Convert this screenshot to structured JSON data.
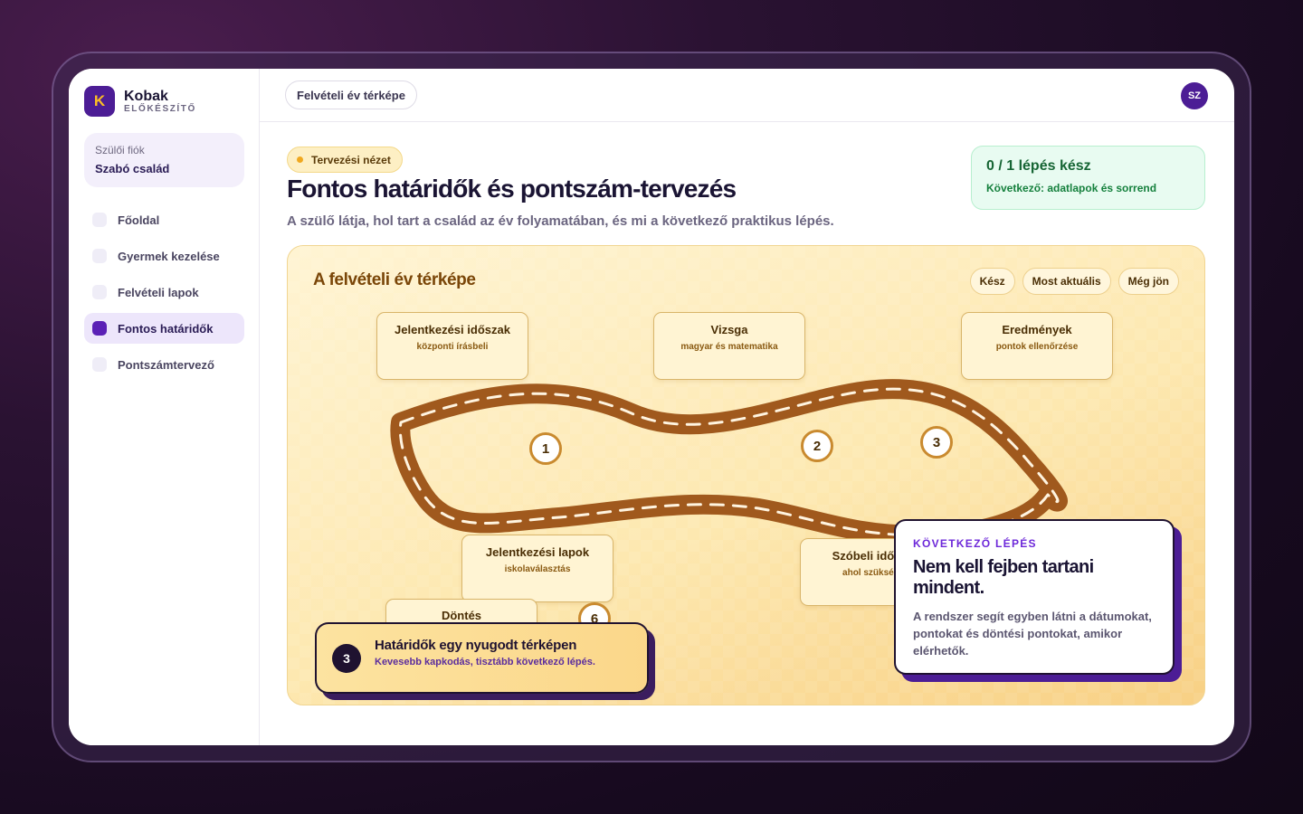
{
  "brand": {
    "logo_letter": "K",
    "name": "Kobak",
    "subtitle": "ELŐKÉSZÍTŐ"
  },
  "account": {
    "label": "Szülői fiók",
    "name": "Szabó család"
  },
  "sidebar": {
    "items": [
      {
        "label": "Főoldal",
        "active": false
      },
      {
        "label": "Gyermek kezelése",
        "active": false
      },
      {
        "label": "Felvételi lapok",
        "active": false
      },
      {
        "label": "Fontos határidők",
        "active": true
      },
      {
        "label": "Pontszámtervező",
        "active": false
      }
    ]
  },
  "topbar": {
    "breadcrumb": "Felvételi év térképe",
    "avatar_initials": "SZ"
  },
  "header": {
    "mode_label": "Tervezési nézet",
    "title": "Fontos határidők és pontszám-tervezés",
    "subtitle": "A szülő látja, hol tart a család az év folyamatában, és mi a következő praktikus lépés."
  },
  "progress": {
    "main": "0 / 1 lépés kész",
    "next": "Következő: adatlapok és sorrend"
  },
  "map": {
    "title": "A felvételi év térképe",
    "legend": [
      "Kész",
      "Most aktuális",
      "Még jön"
    ],
    "stops": [
      {
        "title": "Jelentkezési időszak",
        "sub": "központi írásbeli"
      },
      {
        "title": "Vizsga",
        "sub": "magyar és matematika"
      },
      {
        "title": "Eredmények",
        "sub": "pontok ellenőrzése"
      },
      {
        "title": "Jelentkezési lapok",
        "sub": "iskolaválasztás"
      },
      {
        "title": "Szóbeli időszak",
        "sub": "ahol szükséges"
      },
      {
        "title": "Döntés",
        "sub": ""
      }
    ],
    "markers": [
      "1",
      "2",
      "3",
      "6"
    ],
    "banner": {
      "number": "3",
      "title": "Határidők egy nyugodt térképen",
      "subtitle": "Kevesebb kapkodás, tisztább következő lépés."
    },
    "next_step": {
      "kicker": "KÖVETKEZŐ LÉPÉS",
      "title": "Nem kell fejben tartani mindent.",
      "body": "A rendszer segít egyben látni a dátumokat, pontokat és döntési pontokat, amikor elérhetők."
    }
  },
  "colors": {
    "brand": "#4c1d95",
    "accent": "#fbbf24",
    "road": "#a0591d",
    "success": "#166534"
  }
}
